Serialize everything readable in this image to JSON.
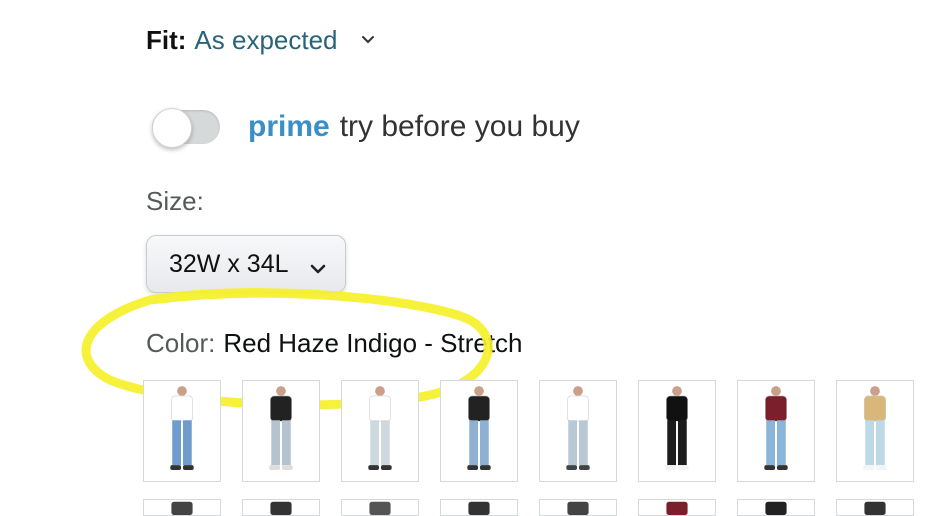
{
  "fit": {
    "label": "Fit:",
    "value": "As expected"
  },
  "prime": {
    "brand": "prime",
    "tagline": "try before you buy",
    "toggle_on": false
  },
  "size": {
    "label": "Size:",
    "selected": "32W x 34L"
  },
  "color": {
    "label": "Color:",
    "selected": "Red Haze Indigo - Stretch"
  },
  "swatches_row1": [
    {
      "top": "#ffffff",
      "jeans": "#6f9ccc",
      "shoes": "#333333"
    },
    {
      "top": "#222222",
      "jeans": "#b4c3cf",
      "shoes": "#dddddd"
    },
    {
      "top": "#ffffff",
      "jeans": "#cdd8df",
      "shoes": "#333333"
    },
    {
      "top": "#222222",
      "jeans": "#8fb0d0",
      "shoes": "#333333"
    },
    {
      "top": "#ffffff",
      "jeans": "#b8c8d4",
      "shoes": "#444444"
    },
    {
      "top": "#111111",
      "jeans": "#1c1c1c",
      "shoes": "#f2f2f2"
    },
    {
      "top": "#7a1f2b",
      "jeans": "#8ab5d8",
      "shoes": "#333333"
    },
    {
      "top": "#d9b77b",
      "jeans": "#bfd8e8",
      "shoes": "#f4f4f4"
    }
  ],
  "swatches_row2": [
    {
      "top": "#444444"
    },
    {
      "top": "#333333"
    },
    {
      "top": "#555555"
    },
    {
      "top": "#333333"
    },
    {
      "top": "#444444"
    },
    {
      "top": "#7a1f2b"
    },
    {
      "top": "#222222"
    },
    {
      "top": "#333333"
    }
  ],
  "colors": {
    "link": "#2a6278",
    "prime": "#3a8fc8",
    "annotation": "#f5f02a"
  }
}
